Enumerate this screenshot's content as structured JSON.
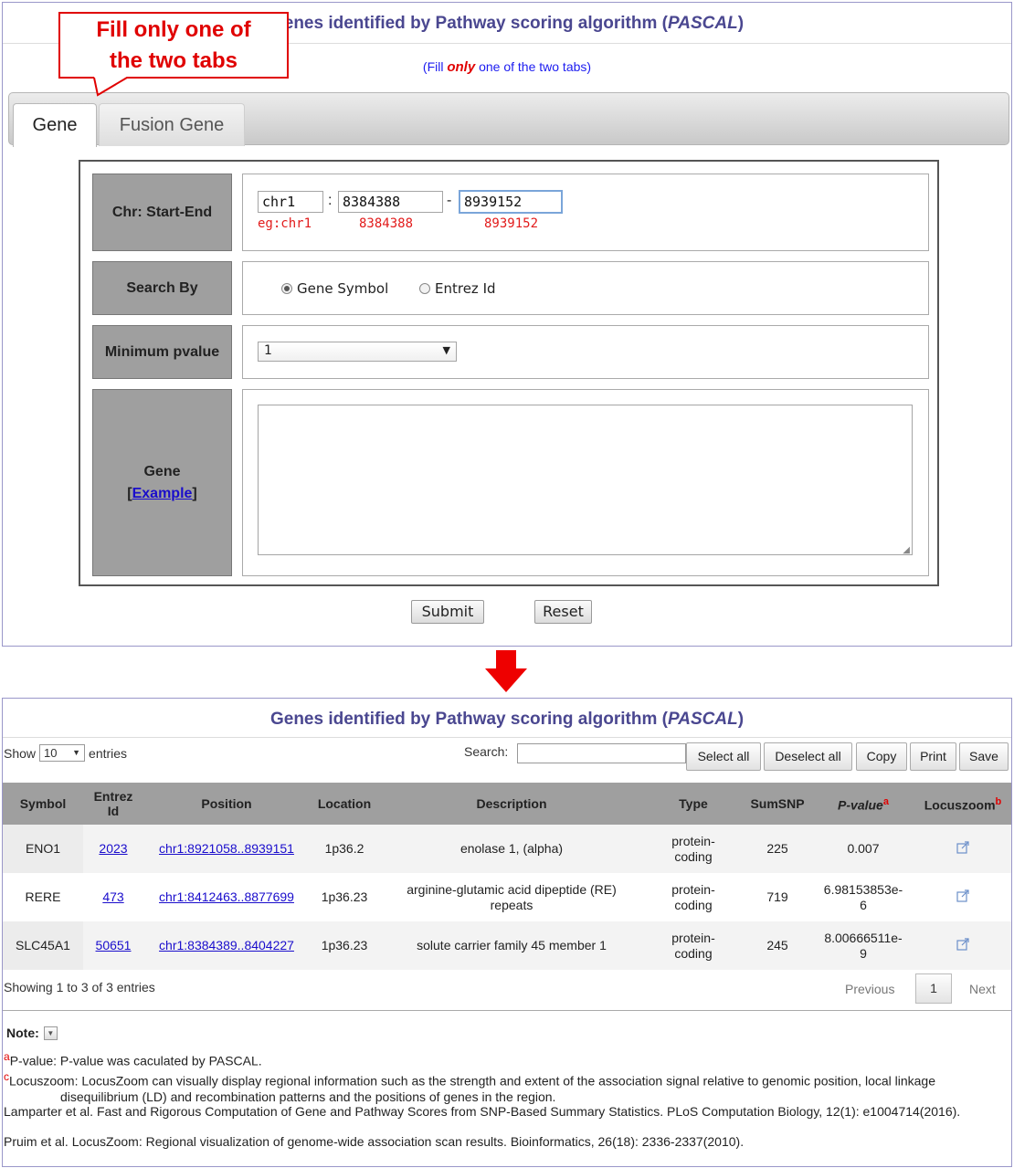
{
  "top": {
    "title": "Genes identified by Pathway scoring algorithm",
    "title_italic": "PASCAL",
    "subtitle_pre": "(Fill ",
    "subtitle_em": "only",
    "subtitle_post": " one of the two tabs)",
    "callout_line1": "Fill only one of",
    "callout_line2": "the two tabs",
    "tabs": [
      {
        "label": "Gene"
      },
      {
        "label": "Fusion Gene"
      }
    ],
    "form": {
      "chr_label": "Chr: Start-End",
      "chr_value": "chr1",
      "start_value": "8384388",
      "end_value": "8939152",
      "colon": ":",
      "dash": "-",
      "eg_chr": "eg:chr1",
      "eg_start": "8384388",
      "eg_end": "8939152",
      "search_label": "Search By",
      "radio_symbol": "Gene Symbol",
      "radio_entrez": "Entrez Id",
      "minp_label": "Minimum pvalue",
      "minp_value": "1",
      "gene_label": "Gene",
      "example_link": "Example",
      "gene_text": ""
    },
    "submit_label": "Submit",
    "reset_label": "Reset"
  },
  "results": {
    "title": "Genes identified by Pathway scoring algorithm",
    "title_italic": "PASCAL",
    "show_label": "Show",
    "show_value": "10",
    "entries_label": "entries",
    "search_label": "Search:",
    "buttons": {
      "select_all": "Select all",
      "deselect_all": "Deselect all",
      "copy": "Copy",
      "print": "Print",
      "save": "Save"
    },
    "columns": {
      "symbol": "Symbol",
      "entrez_1": "Entrez",
      "entrez_2": "Id",
      "position": "Position",
      "location": "Location",
      "description": "Description",
      "type": "Type",
      "sumsnp": "SumSNP",
      "pvalue": "P-value",
      "pvalue_sup": "a",
      "locuszoom": "Locuszoom",
      "locuszoom_sup": "b"
    },
    "rows": [
      {
        "symbol": "ENO1",
        "entrez": "2023",
        "position": "chr1:8921058..8939151",
        "location": "1p36.2",
        "description_1": "enolase 1, (alpha)",
        "description_2": "",
        "type_1": "protein-",
        "type_2": "coding",
        "sumsnp": "225",
        "pvalue_1": "0.007",
        "pvalue_2": ""
      },
      {
        "symbol": "RERE",
        "entrez": "473",
        "position": "chr1:8412463..8877699",
        "location": "1p36.23",
        "description_1": "arginine-glutamic acid dipeptide (RE)",
        "description_2": "repeats",
        "type_1": "protein-",
        "type_2": "coding",
        "sumsnp": "719",
        "pvalue_1": "6.98153853e-",
        "pvalue_2": "6"
      },
      {
        "symbol": "SLC45A1",
        "entrez": "50651",
        "position": "chr1:8384389..8404227",
        "location": "1p36.23",
        "description_1": "solute carrier family 45 member 1",
        "description_2": "",
        "type_1": "protein-",
        "type_2": "coding",
        "sumsnp": "245",
        "pvalue_1": "8.00666511e-",
        "pvalue_2": "9"
      }
    ],
    "info": "Showing 1 to 3 of 3 entries",
    "previous": "Previous",
    "page": "1",
    "next": "Next",
    "note_label": "Note:",
    "note_a_sup": "a",
    "note_a": "P-value: P-value was caculated by PASCAL.",
    "note_c_sup": "c",
    "note_c_1": "Locuszoom: LocusZoom can visually display regional information such as the strength and extent of the association signal relative to genomic position, local linkage",
    "note_c_2": "disequilibrium (LD) and recombination patterns and the positions of genes in the region.",
    "ref_1": "Lamparter et al. Fast and Rigorous Computation of Gene and Pathway Scores from SNP-Based Summary Statistics. PLoS Computation Biology, 12(1): e1004714(2016).",
    "ref_2": "Pruim et al. LocusZoom: Regional visualization of genome-wide association scan results. Bioinformatics, 26(18): 2336-2337(2010)."
  }
}
